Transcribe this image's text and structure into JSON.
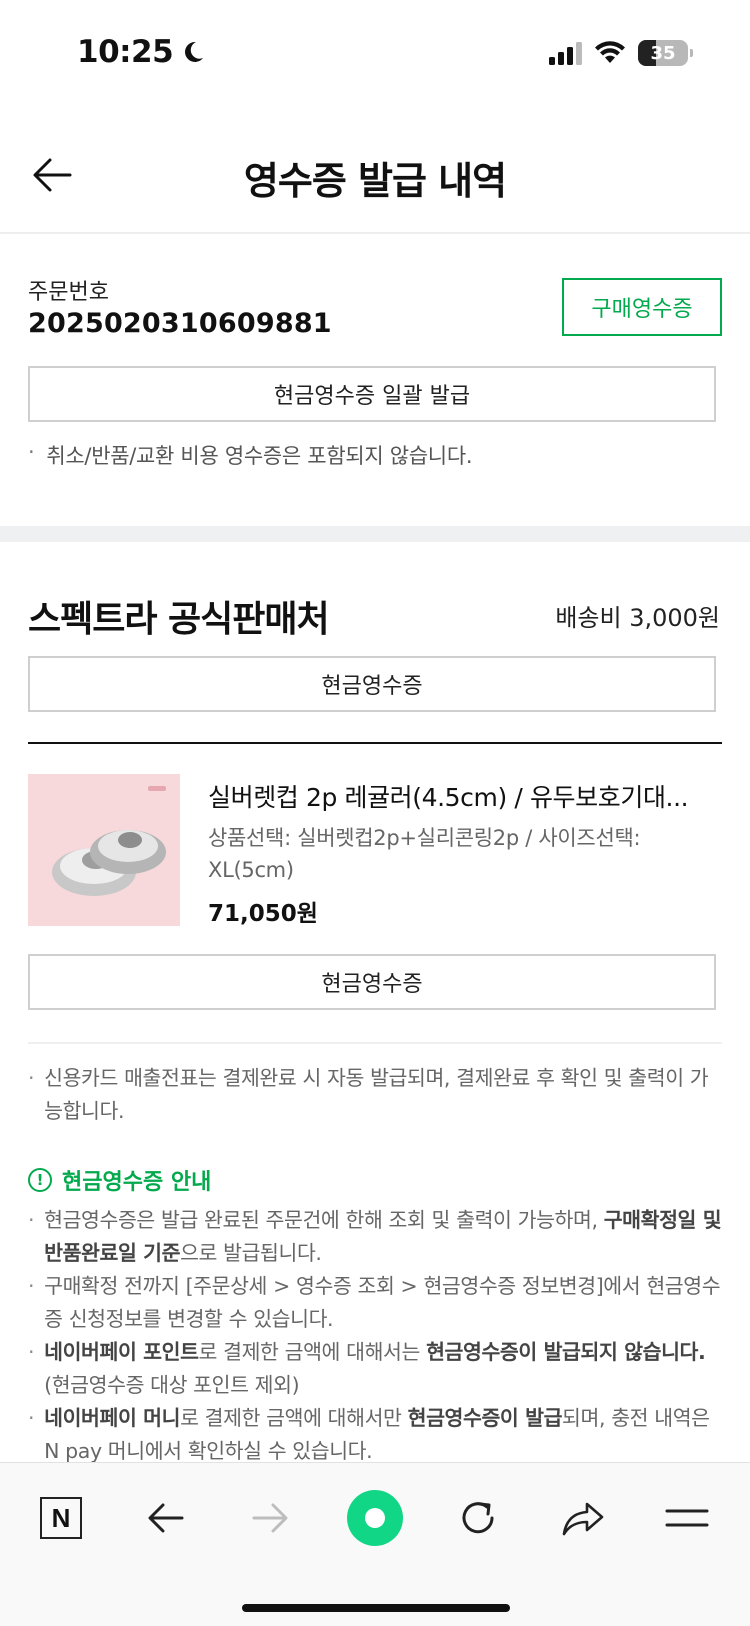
{
  "status_bar": {
    "time": "10:25",
    "battery": "35"
  },
  "header": {
    "title": "영수증 발급 내역"
  },
  "order": {
    "label": "주문번호",
    "number": "2025020310609881",
    "purchase_receipt_button": "구매영수증",
    "bulk_cash_receipt_button": "현금영수증 일괄 발급",
    "note": "취소/반품/교환 비용 영수증은 포함되지 않습니다."
  },
  "seller": {
    "name": "스펙트라 공식판매처",
    "shipping_fee": "배송비 3,000원",
    "cash_receipt_button": "현금영수증"
  },
  "product": {
    "name": "실버렛컵 2p 레귤러(4.5cm) / 유두보호기대...",
    "option_line1": "상품선택: 실버렛컵2p+실리콘링2p / 사이즈선택:",
    "option_line2": "XL(5cm)",
    "price": "71,050원",
    "cash_receipt_button": "현금영수증"
  },
  "info": {
    "card_note": "신용카드 매출전표는 결제완료 시 자동 발급되며, 결제완료 후 확인 및 출력이 가능합니다.",
    "guide_title": "현금영수증 안내",
    "guide1_a": "현금영수증은 발급 완료된 주문건에 한해 조회 및 출력이 가능하며, ",
    "guide1_b": "구매확정일 및 반품완료일 기준",
    "guide1_c": "으로 발급됩니다.",
    "guide2": "구매확정 전까지 [주문상세 > 영수증 조회 > 현금영수증 정보변경]에서 현금영수증 신청정보를 변경할 수 있습니다.",
    "guide3_a": "네이버페이 포인트",
    "guide3_b": "로 결제한 금액에 대해서는 ",
    "guide3_c": "현금영수증이 발급되지 않습니다.",
    "guide3_d": "(현금영수증 대상 포인트 제외)",
    "guide4_a": "네이버페이 머니",
    "guide4_b": "로 결제한 금액에 대해서만 ",
    "guide4_c": "현금영수증이 발급",
    "guide4_d": "되며, 충전 내역은 ",
    "guide4_e": "N pay 머니에서 확인하실 수 있습니다."
  },
  "bottom_nav": {
    "home_label": "N"
  },
  "colors": {
    "accent_green": "#03a94d",
    "band_gray": "#eef0f2"
  }
}
